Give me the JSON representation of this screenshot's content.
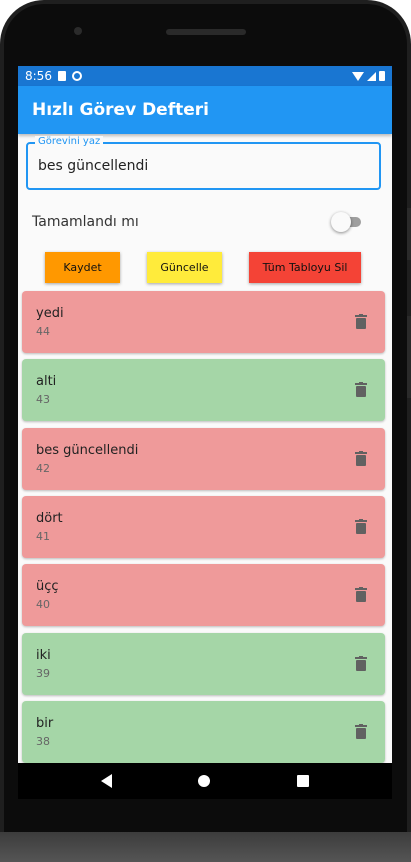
{
  "status_bar": {
    "time": "8:56"
  },
  "app_bar": {
    "title": "Hızlı Görev Defteri"
  },
  "task_input": {
    "label": "Görevini yaz",
    "value": "bes güncellendi"
  },
  "completed_toggle": {
    "label": "Tamamlandı mı",
    "checked": false
  },
  "buttons": {
    "save": "Kaydet",
    "update": "Güncelle",
    "delete_all": "Tüm Tabloyu Sil"
  },
  "colors": {
    "incomplete_card": "#ef9a9a",
    "complete_card": "#a5d6a7",
    "trash_icon": "#616161"
  },
  "tasks": [
    {
      "name": "yedi",
      "id": "44",
      "completed": false,
      "icon": "trash-icon"
    },
    {
      "name": "alti",
      "id": "43",
      "completed": true,
      "icon": "trash-icon"
    },
    {
      "name": "bes güncellendi",
      "id": "42",
      "completed": false,
      "icon": "trash-icon"
    },
    {
      "name": "dört",
      "id": "41",
      "completed": false,
      "icon": "trash-icon"
    },
    {
      "name": "üçç",
      "id": "40",
      "completed": false,
      "icon": "trash-icon"
    },
    {
      "name": "iki",
      "id": "39",
      "completed": true,
      "icon": "trash-icon"
    },
    {
      "name": "bir",
      "id": "38",
      "completed": true,
      "icon": "trash-icon"
    }
  ]
}
